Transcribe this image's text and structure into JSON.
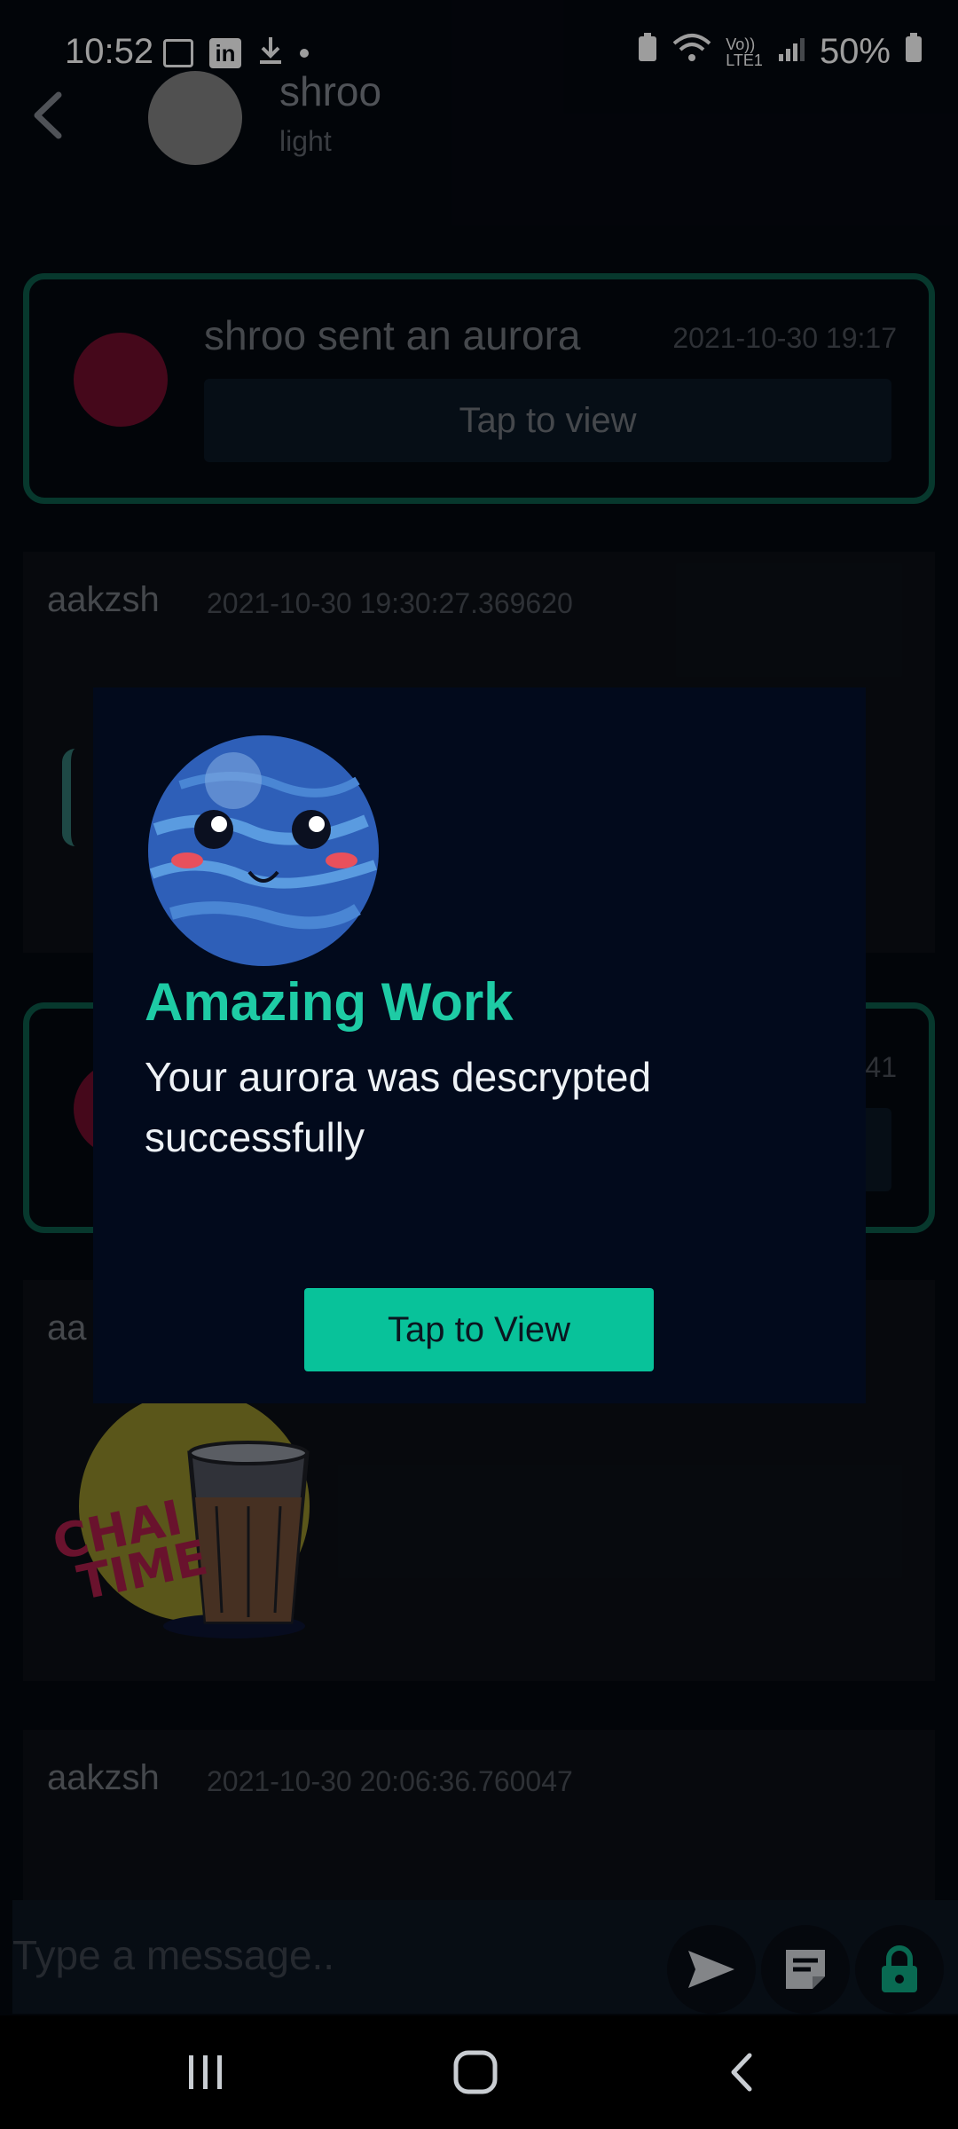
{
  "status_bar": {
    "time": "10:52",
    "battery": "50%",
    "network": "LTE1",
    "network_sup": "Vo))"
  },
  "header": {
    "name": "shroo",
    "status": "light"
  },
  "aurora_cards": [
    {
      "title": "shroo sent an aurora",
      "time": "2021-10-30 19:17",
      "action": "Tap to view"
    },
    {
      "title": "",
      "time": "41",
      "action": ""
    }
  ],
  "messages": [
    {
      "author": "aakzsh",
      "time": "2021-10-30 19:30:27.369620"
    },
    {
      "author": "aa",
      "time": ""
    },
    {
      "author": "aakzsh",
      "time": "2021-10-30 20:06:36.760047"
    }
  ],
  "sticker": {
    "text_line1": "CHAI",
    "text_line2": "TIME"
  },
  "composer": {
    "placeholder": "Type a message.."
  },
  "dialog": {
    "title": "Amazing Work",
    "message": "Your aurora was descrypted successfully",
    "button": "Tap to View"
  },
  "colors": {
    "accent": "#08c29a",
    "card_border": "#0c5646",
    "background": "#04080f",
    "dialog_bg": "#020a1c"
  }
}
